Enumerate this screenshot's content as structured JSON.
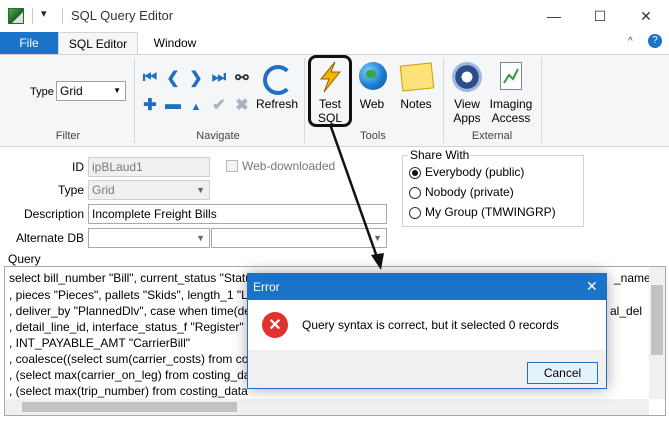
{
  "window": {
    "title": "SQL Query Editor",
    "minimize_glyph": "—",
    "maximize_glyph": "☐",
    "close_glyph": "✕"
  },
  "ribbon": {
    "tabs": [
      {
        "label": "File"
      },
      {
        "label": "SQL Editor"
      },
      {
        "label": "Window"
      }
    ],
    "help_glyph": "?",
    "collapse_glyph": "^",
    "filter": {
      "group_label": "Filter",
      "type_label": "Type",
      "type_value": "Grid"
    },
    "navigate": {
      "group_label": "Navigate",
      "refresh_label": "Refresh"
    },
    "tools": {
      "group_label": "Tools",
      "test_sql_label": "Test SQL",
      "web_label": "Web",
      "notes_label": "Notes"
    },
    "external": {
      "group_label": "External",
      "view_apps_label": "View Apps",
      "imaging_access_label": "Imaging Access"
    }
  },
  "form": {
    "id_label": "ID",
    "id_value": "ipBLaud1",
    "web_downloaded_label": "Web-downloaded",
    "type_label": "Type",
    "type_value": "Grid",
    "description_label": "Description",
    "description_value": "Incomplete Freight Bills",
    "alternate_db_label": "Alternate DB",
    "alternate_db_value": "",
    "share_with": {
      "title": "Share With",
      "options": [
        {
          "label": "Everybody (public)",
          "selected": true
        },
        {
          "label": "Nobody (private)",
          "selected": false
        },
        {
          "label": "My Group (TMWINGRP)",
          "selected": false
        }
      ]
    }
  },
  "query": {
    "label": "Query",
    "lines": [
      "select bill_number \"Bill\", current_status \"Statu",
      ", pieces \"Pieces\", pallets \"Skids\", length_1 \"Le",
      ", deliver_by \"PlannedDlv\", case when time(de",
      ", detail_line_id, interface_status_f \"Register\"",
      ", INT_PAYABLE_AMT \"CarrierBill\"",
      ", coalesce((select sum(carrier_costs) from cos",
      ", (select max(carrier_on_leg) from costing_dat",
      ", (select max(trip_number) from costing_data"
    ],
    "right_fragments": [
      "_name",
      "al_del"
    ]
  },
  "dialog": {
    "title": "Error",
    "close_glyph": "✕",
    "message": "Query syntax is correct, but it selected 0 records",
    "cancel_label": "Cancel"
  },
  "colors": {
    "accent": "#1a73c8",
    "error": "#e0312f",
    "annotation": "#111111"
  }
}
